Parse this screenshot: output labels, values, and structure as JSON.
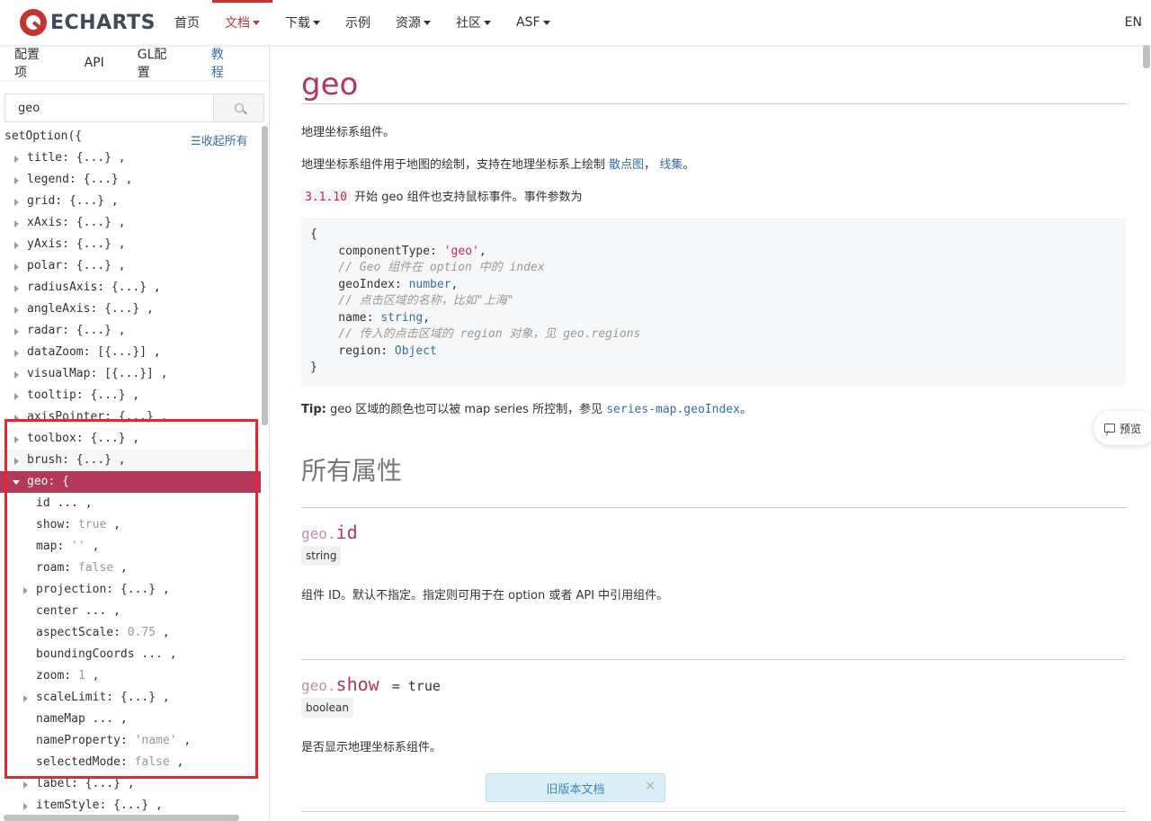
{
  "nav": {
    "logo_text": "ECHARTS",
    "items": [
      {
        "label": "首页",
        "dropdown": false,
        "active": false
      },
      {
        "label": "文档",
        "dropdown": true,
        "active": true
      },
      {
        "label": "下载",
        "dropdown": true,
        "active": false
      },
      {
        "label": "示例",
        "dropdown": false,
        "active": false
      },
      {
        "label": "资源",
        "dropdown": true,
        "active": false
      },
      {
        "label": "社区",
        "dropdown": true,
        "active": false
      },
      {
        "label": "ASF",
        "dropdown": true,
        "active": false
      }
    ],
    "lang": "EN"
  },
  "sidebar": {
    "tabs": [
      "配置项",
      "API",
      "GL配置",
      "教程"
    ],
    "active_tab": 3,
    "search_value": "geo",
    "set_option": "setOption({",
    "collapse_all": "☰收起所有",
    "top_items": [
      "title: {...} ,",
      "legend: {...} ,",
      "grid: {...} ,",
      "xAxis: {...} ,",
      "yAxis: {...} ,",
      "polar: {...} ,",
      "radiusAxis: {...} ,",
      "angleAxis: {...} ,",
      "radar: {...} ,",
      "dataZoom: [{...}] ,",
      "visualMap: [{...}] ,",
      "tooltip: {...} ,",
      "axisPointer: {...} ,",
      "toolbox: {...} ,",
      "brush: {...} ,"
    ],
    "geo_label": "geo: {",
    "geo_children": [
      {
        "key": "id",
        "rest": " ... ,",
        "def": "",
        "expand": false
      },
      {
        "key": "show: ",
        "rest": " ,",
        "def": "true",
        "expand": false
      },
      {
        "key": "map: ",
        "rest": " ,",
        "def": "''",
        "expand": false
      },
      {
        "key": "roam: ",
        "rest": " ,",
        "def": "false",
        "expand": false
      },
      {
        "key": "projection: ",
        "rest": "{...} ,",
        "def": "",
        "expand": true
      },
      {
        "key": "center",
        "rest": " ... ,",
        "def": "",
        "expand": false
      },
      {
        "key": "aspectScale: ",
        "rest": " ,",
        "def": "0.75",
        "expand": false
      },
      {
        "key": "boundingCoords",
        "rest": " ... ,",
        "def": "",
        "expand": false
      },
      {
        "key": "zoom: ",
        "rest": " ,",
        "def": "1",
        "expand": false
      },
      {
        "key": "scaleLimit: ",
        "rest": "{...} ,",
        "def": "",
        "expand": true
      },
      {
        "key": "nameMap",
        "rest": " ... ,",
        "def": "",
        "expand": false
      },
      {
        "key": "nameProperty: ",
        "rest": " ,",
        "def": "'name'",
        "expand": false
      },
      {
        "key": "selectedMode: ",
        "rest": " ,",
        "def": "false",
        "expand": false
      },
      {
        "key": "label: ",
        "rest": "{...} ,",
        "def": "",
        "expand": true
      },
      {
        "key": "itemStyle: ",
        "rest": "{...} ,",
        "def": "",
        "expand": true
      }
    ]
  },
  "main": {
    "title": "geo",
    "p1": "地理坐标系组件。",
    "p2_text": "地理坐标系组件用于地图的绘制，支持在地理坐标系上绘制",
    "p2_link1": "散点图",
    "p2_sep": "，",
    "p2_link2": "线集",
    "p2_end": "。",
    "p3_code": "3.1.10",
    "p3_text": "开始 geo 组件也支持鼠标事件。事件参数为",
    "code_lines": [
      [
        {
          "t": "{",
          "c": ""
        }
      ],
      [
        {
          "t": "    componentType: ",
          "c": ""
        },
        {
          "t": "'geo'",
          "c": "str"
        },
        {
          "t": ",",
          "c": ""
        }
      ],
      [
        {
          "t": "    // Geo 组件在 option 中的 index",
          "c": "com"
        }
      ],
      [
        {
          "t": "    geoIndex: ",
          "c": ""
        },
        {
          "t": "number",
          "c": "typ"
        },
        {
          "t": ",",
          "c": ""
        }
      ],
      [
        {
          "t": "    // 点击区域的名称，比如\"上海\"",
          "c": "com"
        }
      ],
      [
        {
          "t": "    name: ",
          "c": ""
        },
        {
          "t": "string",
          "c": "typ"
        },
        {
          "t": ",",
          "c": ""
        }
      ],
      [
        {
          "t": "    // 传入的点击区域的 region 对象，见 geo.regions",
          "c": "com"
        }
      ],
      [
        {
          "t": "    region: ",
          "c": ""
        },
        {
          "t": "Object",
          "c": "typ"
        }
      ],
      [
        {
          "t": "}",
          "c": ""
        }
      ]
    ],
    "tip_label": "Tip:",
    "tip_text": " geo 区域的颜色也可以被 map series 所控制，参见",
    "tip_link": "series-map.geoIndex",
    "tip_end": "。",
    "section_title": "所有属性",
    "props": [
      {
        "prefix": "geo.",
        "name": "id",
        "default": "",
        "type": "string",
        "desc": "组件 ID。默认不指定。指定则可用于在 option 或者 API 中引用组件。"
      },
      {
        "prefix": "geo.",
        "name": "show",
        "default": "= true",
        "type": "boolean",
        "desc": "是否显示地理坐标系组件。"
      }
    ],
    "preview": "预览",
    "old_version": "旧版本文档",
    "old_close": "×"
  },
  "colors": {
    "accent": "#b3385a",
    "link": "#3a6ea5",
    "highlight_box": "#e3262f"
  }
}
